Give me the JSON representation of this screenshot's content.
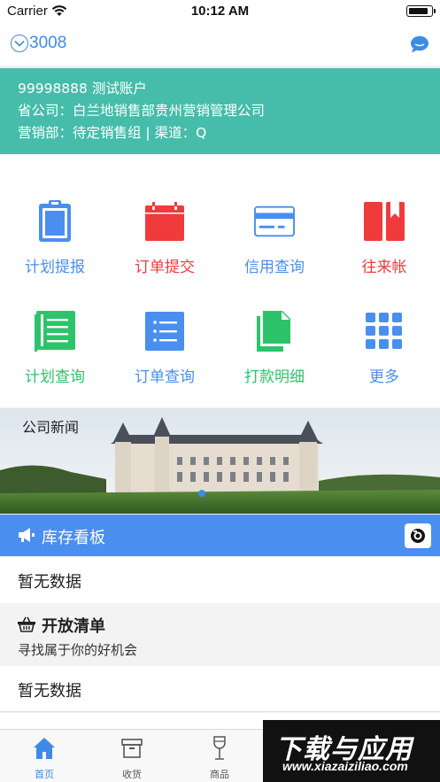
{
  "status_bar": {
    "carrier": "Carrier",
    "time": "10:12 AM",
    "battery_level": 0.9
  },
  "nav": {
    "account_label": "3008"
  },
  "account_info": {
    "line1": "99998888 测试账户",
    "line2": "省公司：白兰地销售部贵州营销管理公司",
    "line3": "营销部：待定销售组 | 渠道：Q"
  },
  "colors": {
    "teal": "#46bcaa",
    "blue": "#4a8ef0",
    "red": "#ef3b3b",
    "green": "#2dc36a"
  },
  "menu": [
    {
      "label": "计划提报",
      "icon": "clipboard-icon",
      "color": "#4a8ef0"
    },
    {
      "label": "订单提交",
      "icon": "calendar-icon",
      "color": "#ef3b3b"
    },
    {
      "label": "信用查询",
      "icon": "credit-card-icon",
      "color": "#4a8ef0"
    },
    {
      "label": "往来帐",
      "icon": "book-icon",
      "color": "#ef3b3b"
    },
    {
      "label": "计划查询",
      "icon": "document-list-icon",
      "color": "#2dc36a"
    },
    {
      "label": "订单查询",
      "icon": "list-icon",
      "color": "#4a8ef0"
    },
    {
      "label": "打款明细",
      "icon": "files-icon",
      "color": "#2dc36a"
    },
    {
      "label": "更多",
      "icon": "grid-icon",
      "color": "#4a8ef0"
    }
  ],
  "banner": {
    "title": "公司新闻"
  },
  "inventory": {
    "title": "库存看板",
    "empty": "暂无数据"
  },
  "open_list": {
    "title": "开放清单",
    "subtitle": "寻找属于你的好机会",
    "empty": "暂无数据"
  },
  "tabs": [
    {
      "label": "首页",
      "icon": "home-icon",
      "active": true
    },
    {
      "label": "收货",
      "icon": "box-icon",
      "active": false
    },
    {
      "label": "商品",
      "icon": "wine-glass-icon",
      "active": false
    }
  ],
  "watermark": {
    "title": "下载与应用",
    "url": "www.xiazaiziliao.com"
  }
}
